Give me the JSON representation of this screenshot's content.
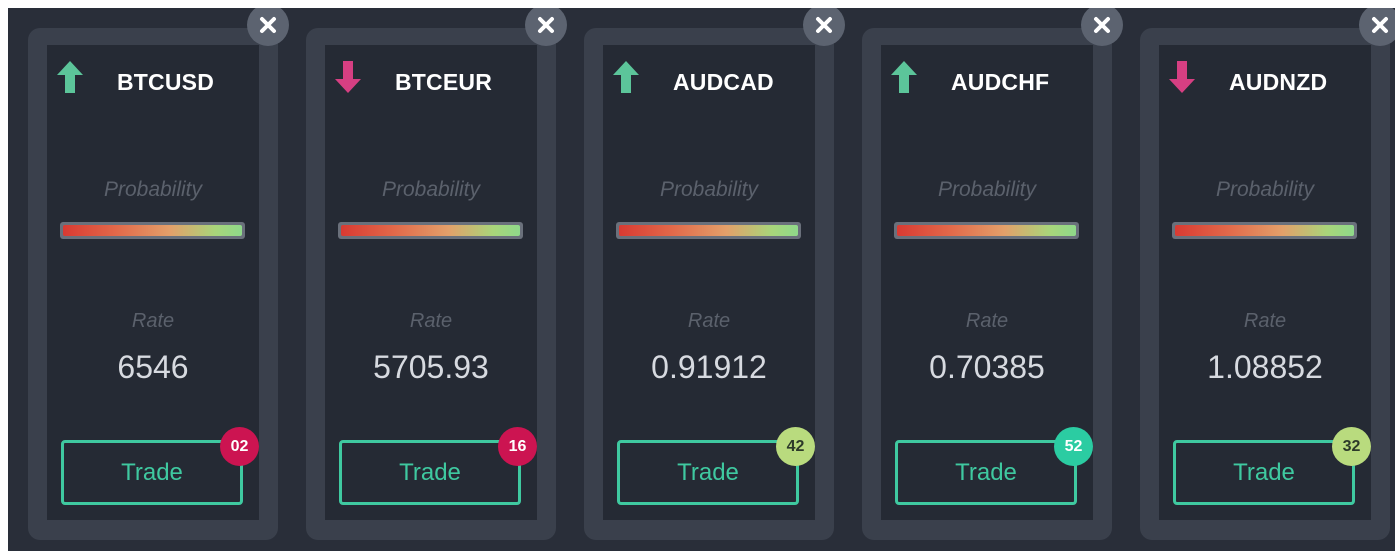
{
  "labels": {
    "probability": "Probability",
    "rate": "Rate",
    "trade": "Trade"
  },
  "colors": {
    "background": "#292e39",
    "card": "#3a404c",
    "card_inner": "#252a34",
    "up": "#5cc59a",
    "down": "#d63f82",
    "trade": "#3fc9a0",
    "probability_gradient": [
      "#d93a32",
      "#e3a06a",
      "#8fd98a"
    ]
  },
  "cards": [
    {
      "symbol": "BTCUSD",
      "direction": "up",
      "direction_icon": "arrow-up-icon",
      "probability_level": 1.0,
      "rate": "6546",
      "trades_count": "02",
      "badge_color": "#cc1451",
      "badge_text_color": "#ffffff"
    },
    {
      "symbol": "BTCEUR",
      "direction": "down",
      "direction_icon": "arrow-down-icon",
      "probability_level": 1.0,
      "rate": "5705.93",
      "trades_count": "16",
      "badge_color": "#cc1451",
      "badge_text_color": "#ffffff"
    },
    {
      "symbol": "AUDCAD",
      "direction": "up",
      "direction_icon": "arrow-up-icon",
      "probability_level": 1.0,
      "rate": "0.91912",
      "trades_count": "42",
      "badge_color": "#b9db7e",
      "badge_text_color": "#2d3a2a"
    },
    {
      "symbol": "AUDCHF",
      "direction": "up",
      "direction_icon": "arrow-up-icon",
      "probability_level": 1.0,
      "rate": "0.70385",
      "trades_count": "52",
      "badge_color": "#2bcca2",
      "badge_text_color": "#ffffff"
    },
    {
      "symbol": "AUDNZD",
      "direction": "down",
      "direction_icon": "arrow-down-icon",
      "probability_level": 1.0,
      "rate": "1.08852",
      "trades_count": "32",
      "badge_color": "#b9db7e",
      "badge_text_color": "#2d3a2a"
    }
  ]
}
